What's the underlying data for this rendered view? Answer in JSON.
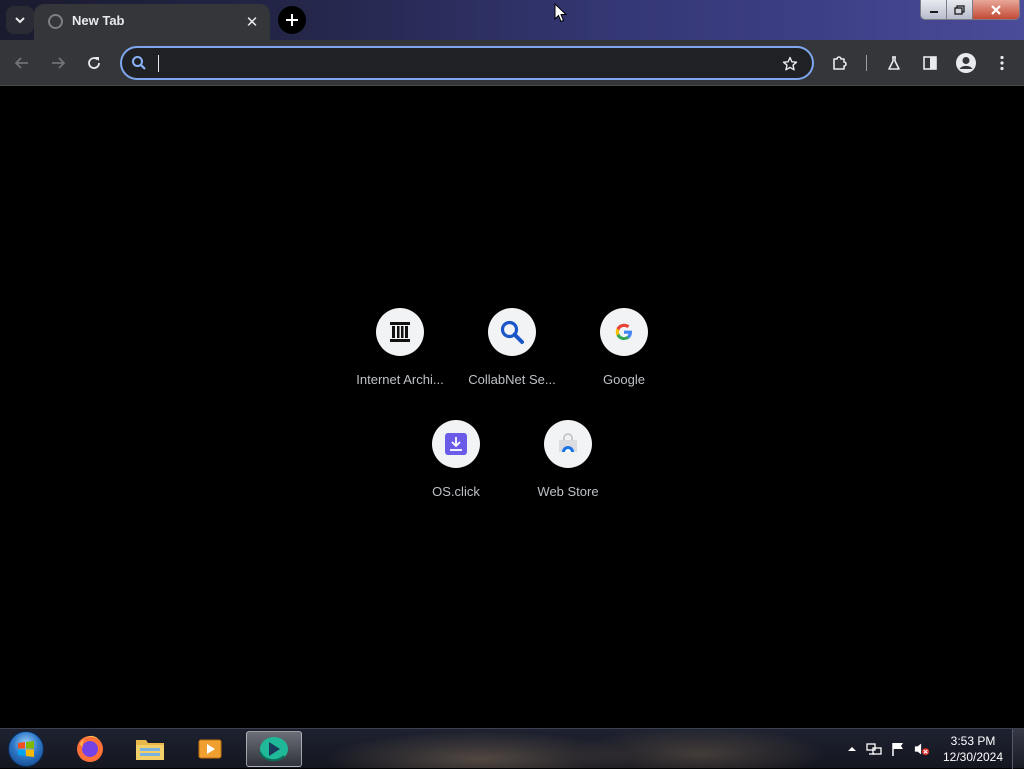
{
  "tab": {
    "title": "New Tab",
    "close_glyph": "✕"
  },
  "omnibox": {
    "value": "",
    "placeholder": ""
  },
  "shortcuts": [
    {
      "label": "Internet Archi...",
      "icon": "archive-temple-icon"
    },
    {
      "label": "CollabNet Se...",
      "icon": "search-magnifier-icon"
    },
    {
      "label": "Google",
      "icon": "google-g-icon"
    },
    {
      "label": "OS.click",
      "icon": "download-icon"
    },
    {
      "label": "Web Store",
      "icon": "web-store-icon"
    }
  ],
  "taskbar": {
    "time": "3:53 PM",
    "date": "12/30/2024",
    "apps": [
      "firefox-icon",
      "file-explorer-icon",
      "media-player-icon",
      "browser-icon"
    ]
  },
  "colors": {
    "accent": "#7ea7ef",
    "page_background": "#000000",
    "toolbar": "#35363a"
  }
}
